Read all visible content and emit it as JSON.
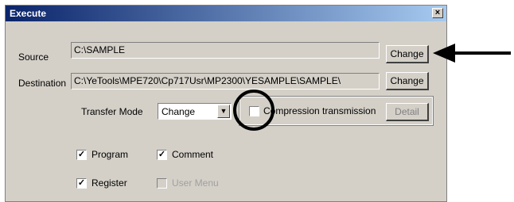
{
  "window": {
    "title": "Execute",
    "close_glyph": "×"
  },
  "source": {
    "label": "Source",
    "value": "C:\\SAMPLE",
    "button": "Change"
  },
  "destination": {
    "label": "Destination",
    "value": "C:\\YeTools\\MPE720\\Cp717Usr\\MP2300\\YESAMPLE\\SAMPLE\\",
    "button": "Change"
  },
  "transfer": {
    "label": "Transfer Mode",
    "selected": "Change",
    "compression_label": "Compression transmission",
    "compression_checked": false,
    "detail_button": "Detail"
  },
  "options": [
    {
      "label": "Program",
      "checked": true,
      "enabled": true
    },
    {
      "label": "Comment",
      "checked": true,
      "enabled": true
    },
    {
      "label": "Register",
      "checked": true,
      "enabled": true
    },
    {
      "label": "User Menu",
      "checked": false,
      "enabled": false
    }
  ],
  "check_glyph": "✓",
  "arrow_glyph": "▼"
}
